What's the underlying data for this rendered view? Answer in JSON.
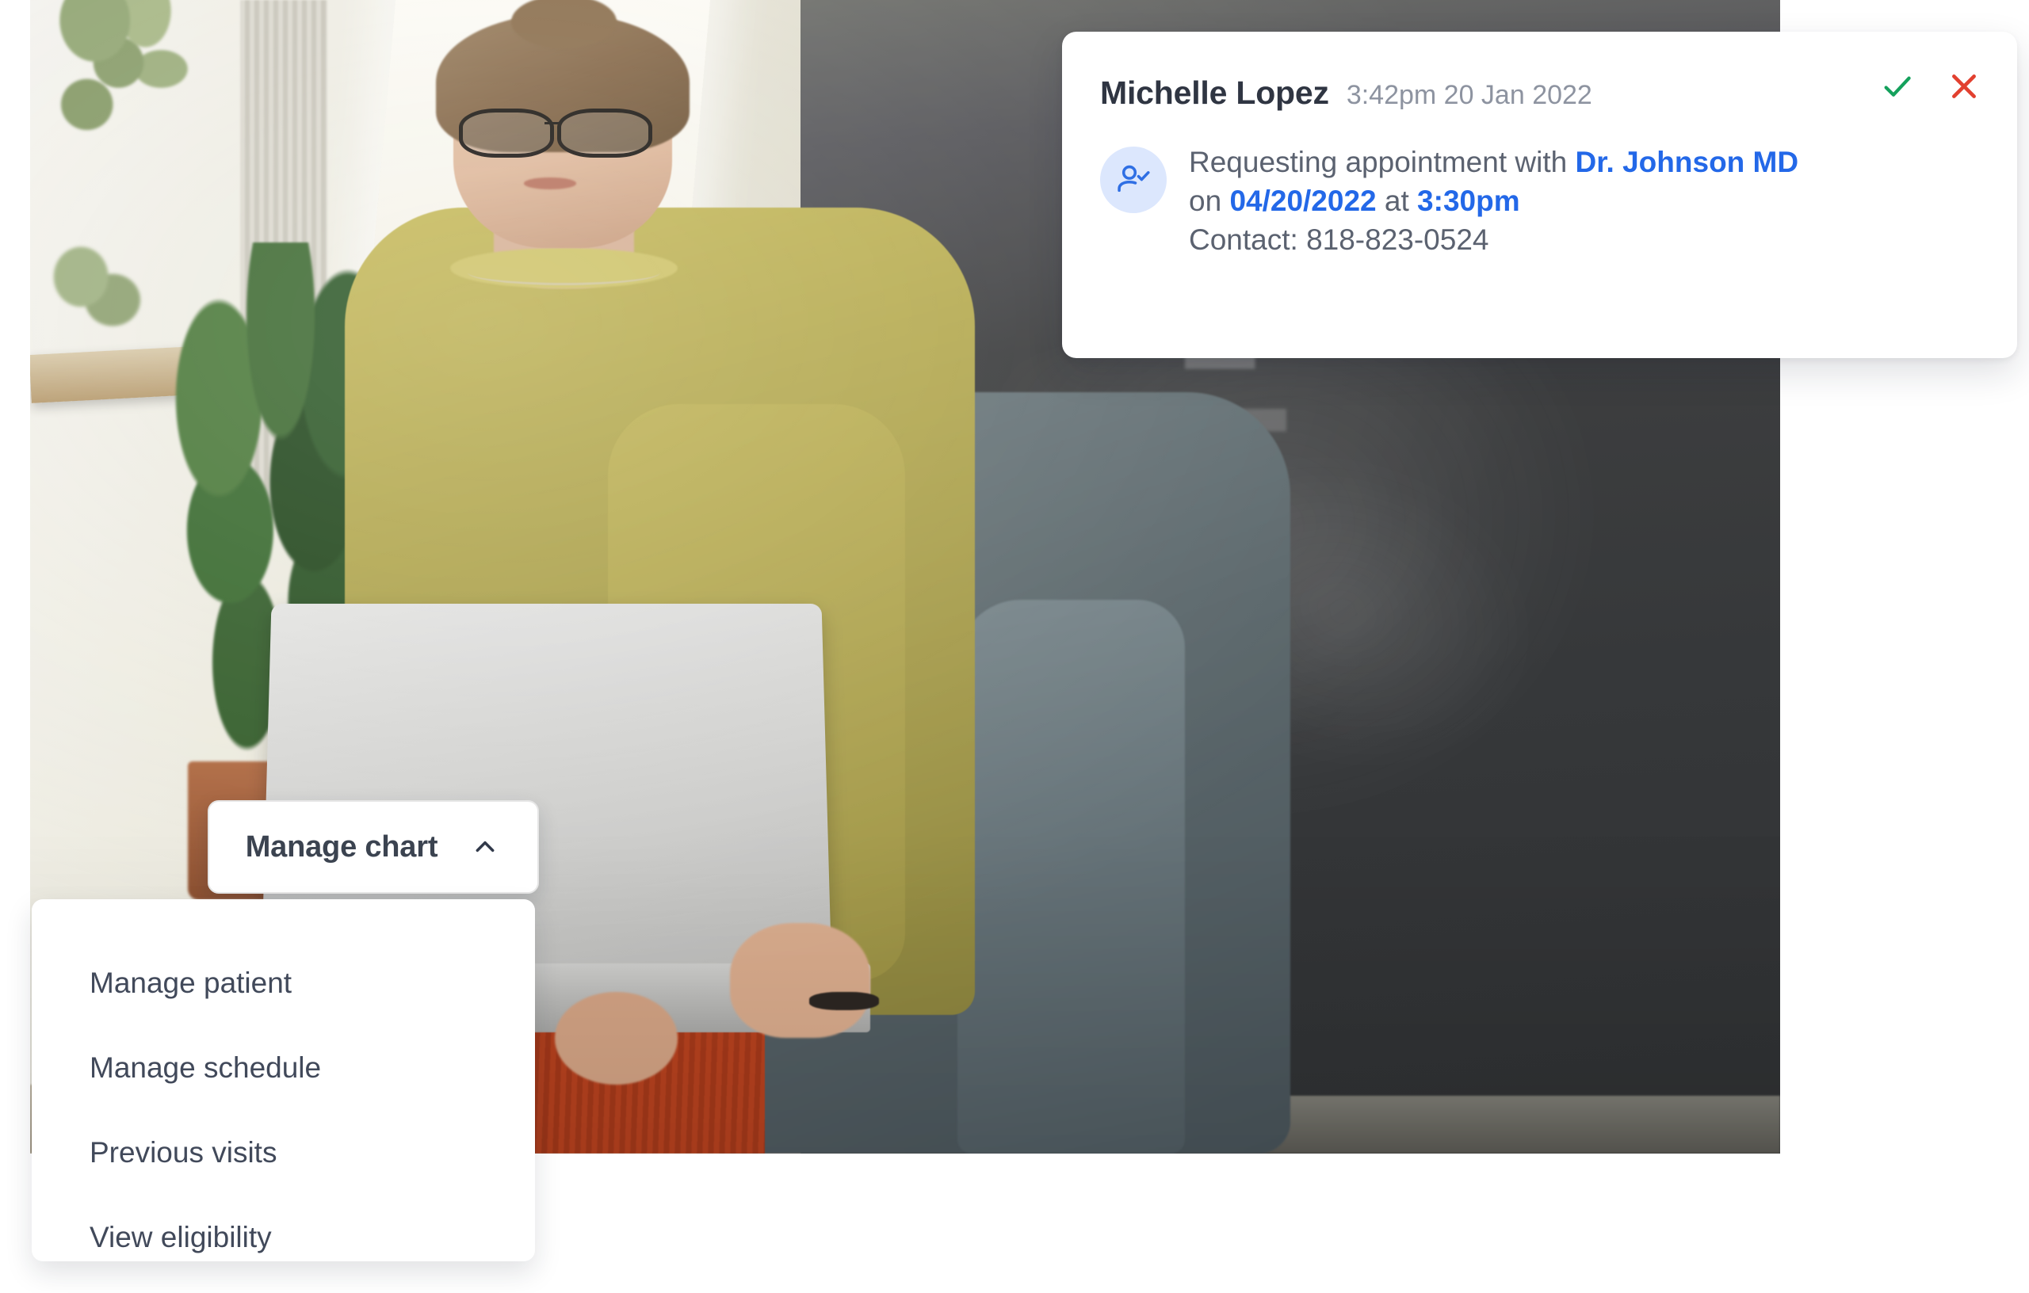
{
  "notification": {
    "patient_name": "Michelle Lopez",
    "timestamp": "3:42pm 20 Jan 2022",
    "accept_icon": "check-icon",
    "decline_icon": "close-icon",
    "avatar_icon": "person-check-icon",
    "message": {
      "prefix": "Requesting appointment with ",
      "doctor": "Dr. Johnson MD",
      "on_label": "on ",
      "date": "04/20/2022",
      "at_label": " at ",
      "time": "3:30pm",
      "contact_line": "Contact: 818-823-0524"
    },
    "colors": {
      "accept": "#14a15c",
      "decline": "#e2402f",
      "highlight": "#2368e8",
      "avatar_bg": "#dce7fd"
    }
  },
  "manage_chart": {
    "label": "Manage chart",
    "chevron_icon": "chevron-up-icon",
    "expanded": true
  },
  "dropdown": {
    "items": [
      {
        "label": "Manage patient"
      },
      {
        "label": "Manage schedule"
      },
      {
        "label": "Previous visits"
      },
      {
        "label": "View eligibility"
      }
    ]
  }
}
